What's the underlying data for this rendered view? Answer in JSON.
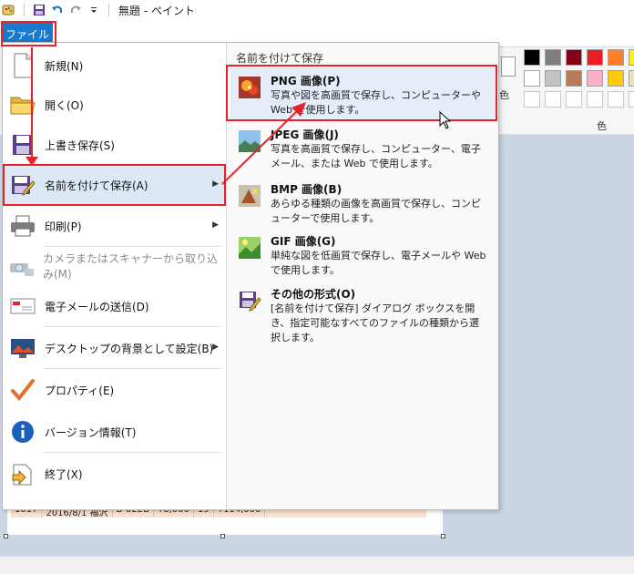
{
  "window": {
    "title": "無題 - ペイント"
  },
  "ribbon": {
    "file_tab": "ファイル",
    "palette_label": "色",
    "partial_label": "色",
    "palette_colors": [
      "#000000",
      "#7f7f7f",
      "#880015",
      "#ed1c24",
      "#ff7f27",
      "#fff200",
      "#ffffff",
      "#c3c3c3",
      "#b97a57",
      "#ffaec9",
      "#ffc90e",
      "#efe4b0"
    ]
  },
  "file_menu": {
    "items": [
      {
        "label": "新規(N)",
        "icon": "new-document-icon"
      },
      {
        "label": "開く(O)",
        "icon": "open-folder-icon"
      },
      {
        "label": "上書き保存(S)",
        "icon": "save-disk-icon"
      },
      {
        "label": "名前を付けて保存(A)",
        "icon": "save-as-icon",
        "submenu": true
      },
      {
        "label": "印刷(P)",
        "icon": "printer-icon",
        "submenu": true
      },
      {
        "label": "カメラまたはスキャナーから取り込み(M)",
        "icon": "scanner-icon",
        "disabled": true
      },
      {
        "label": "電子メールの送信(D)",
        "icon": "email-icon"
      },
      {
        "label": "デスクトップの背景として設定(B)",
        "icon": "desktop-background-icon",
        "submenu": true
      },
      {
        "label": "プロパティ(E)",
        "icon": "check-mark-icon"
      },
      {
        "label": "バージョン情報(T)",
        "icon": "info-icon"
      },
      {
        "label": "終了(X)",
        "icon": "exit-icon"
      }
    ]
  },
  "save_as_panel": {
    "header": "名前を付けて保存",
    "options": [
      {
        "title": "PNG 画像(P)",
        "description": "写真や図を高画質で保存し、コンピューターや Web で使用します。",
        "icon": "png-image-icon"
      },
      {
        "title": "JPEG 画像(J)",
        "description": "写真を高画質で保存し、コンピューター、電子メール、または Web で使用します。",
        "icon": "jpeg-image-icon"
      },
      {
        "title": "BMP 画像(B)",
        "description": "あらゆる種類の画像を高画質で保存し、コンピューターで使用します。",
        "icon": "bmp-image-icon"
      },
      {
        "title": "GIF 画像(G)",
        "description": "単純な図を低画質で保存し、電子メールや Web で使用します。",
        "icon": "gif-image-icon"
      },
      {
        "title": "その他の形式(O)",
        "description": "[名前を付けて保存] ダイアログ ボックスを開き、指定可能なすべてのファイルの種類から選択します。",
        "icon": "other-formats-icon"
      }
    ]
  },
  "canvas_row": [
    "1017",
    "2016/8/1 福沢",
    "B-022B",
    "¥8,000",
    "19",
    "¥114,000"
  ],
  "accent_colors": {
    "file_tab": "#1979ca",
    "annotation": "#e8212d",
    "hover": "#dce9f5"
  }
}
